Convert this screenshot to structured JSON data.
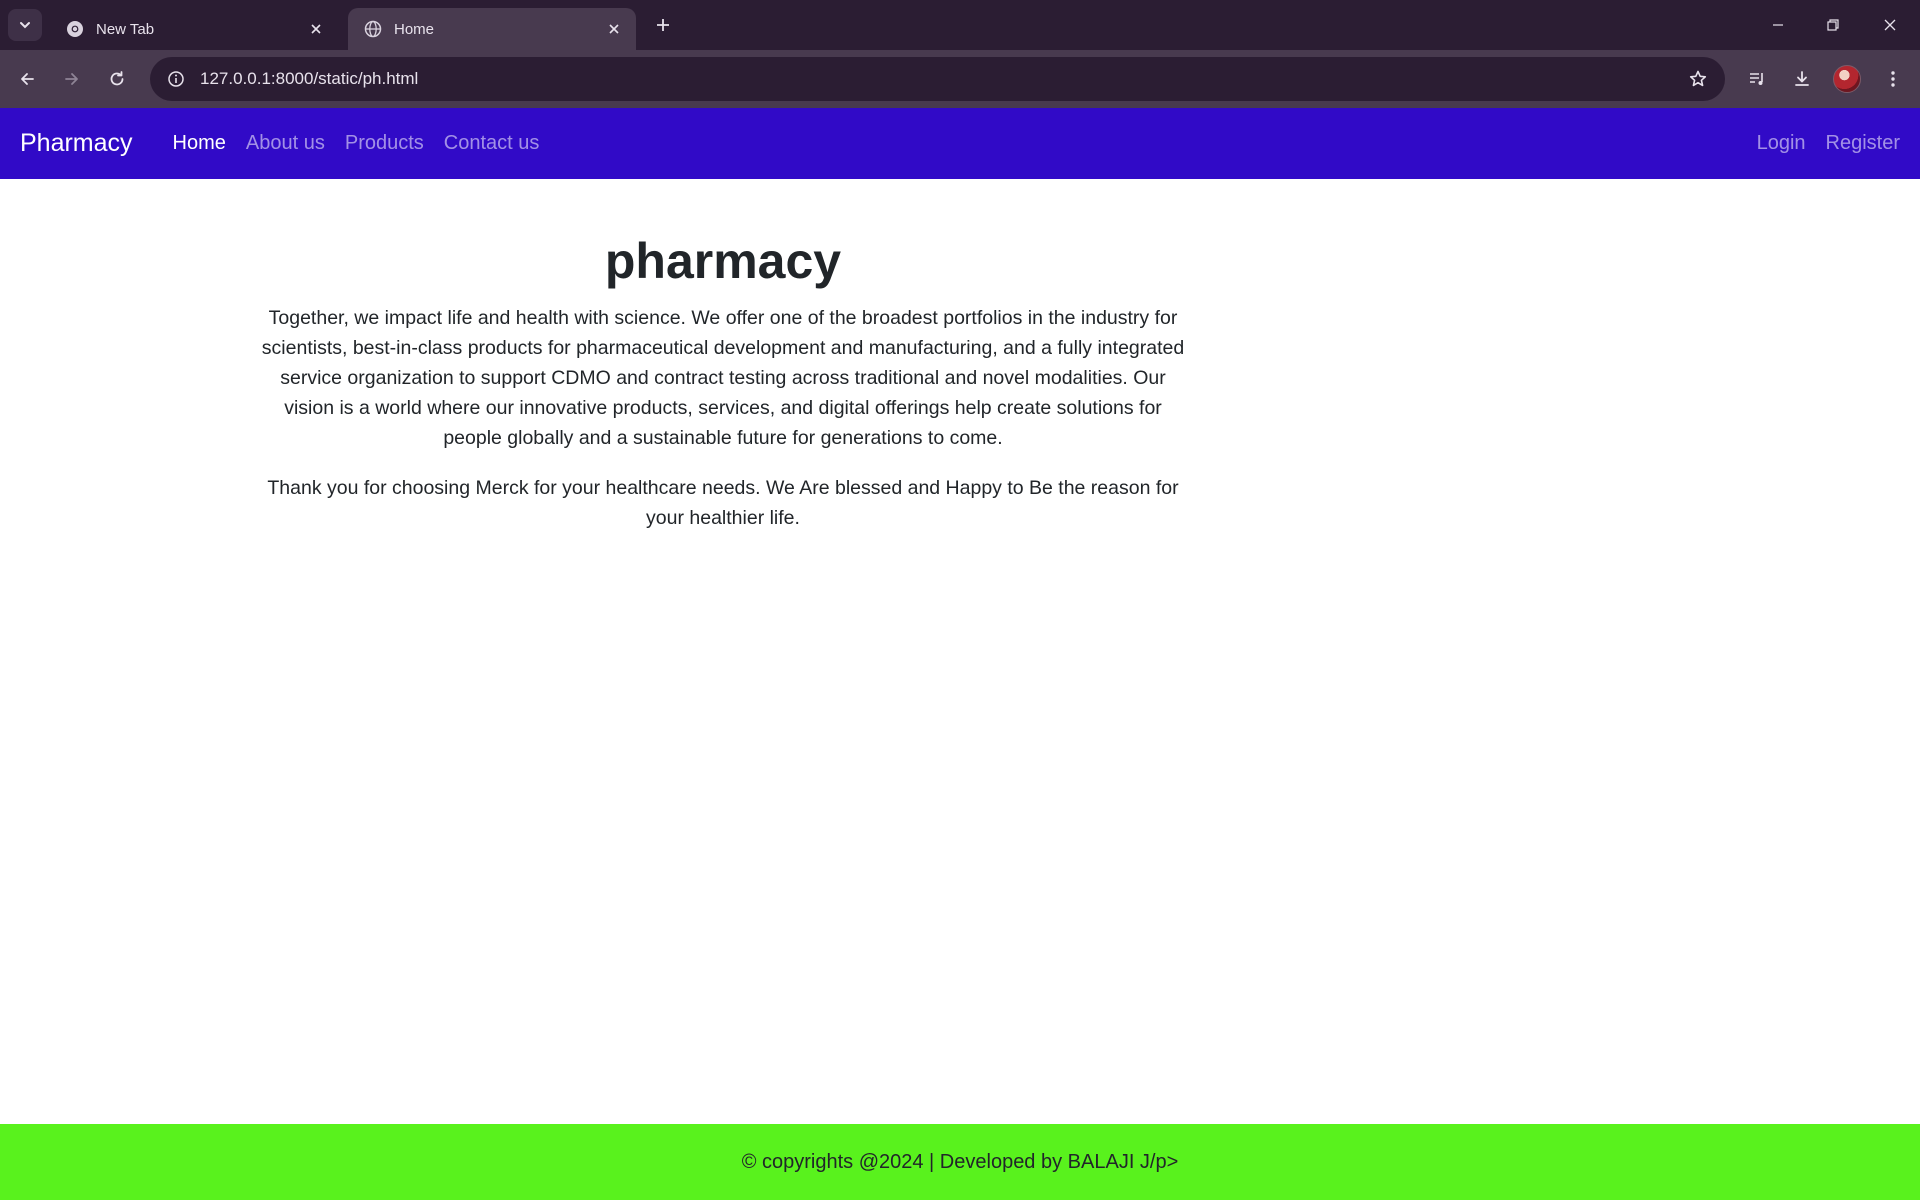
{
  "browser": {
    "tabs": [
      {
        "title": "New Tab",
        "icon": "chrome-icon",
        "active": false
      },
      {
        "title": "Home",
        "icon": "globe-icon",
        "active": true
      }
    ],
    "url": "127.0.0.1:8000/static/ph.html"
  },
  "navbar": {
    "brand": "Pharmacy",
    "links": [
      "Home",
      "About us",
      "Products",
      "Contact us"
    ],
    "active_link": "Home",
    "right_links": [
      "Login",
      "Register"
    ],
    "background": "#310ac7"
  },
  "main": {
    "heading": "pharmacy",
    "paragraph1": "Together, we impact life and health with science. We offer one of the broadest portfolios in the industry for scientists, best-in-class products for pharmaceutical development and manufacturing, and a fully integrated service organization to support CDMO and contract testing across traditional and novel modalities. Our vision is a world where our innovative products, services, and digital offerings help create solutions for people globally and a sustainable future for generations to come.",
    "paragraph2": "Thank you for choosing Merck for your healthcare needs. We Are blessed and Happy to Be the reason for your healthier life."
  },
  "footer": {
    "text": "© copyrights @2024 | Developed by BALAJI J/p>",
    "background": "#59f21d"
  }
}
